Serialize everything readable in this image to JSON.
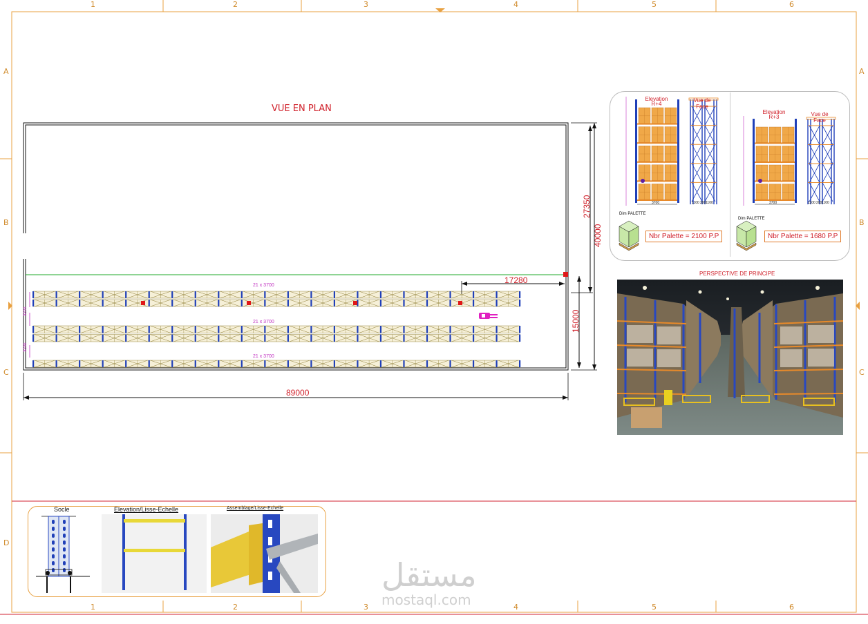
{
  "sheet": {
    "columns": [
      "1",
      "2",
      "3",
      "4",
      "5",
      "6"
    ],
    "rows": [
      "A",
      "B",
      "C",
      "D"
    ]
  },
  "plan": {
    "title": "VUE EN PLAN",
    "dim_width": "89000",
    "dim_height_total": "40000",
    "dim_height_upper": "27350",
    "dim_height_lower": "15000",
    "dim_aisle": "17280",
    "rack_label": "21 x 3700",
    "spacing_label": "3200"
  },
  "elevation_left": {
    "title": "Elevation",
    "subtitle": "R+4",
    "face_title": "Vue de Face",
    "palette_label": "Dim PALETTE",
    "count": "Nbr Palette = 2100 P.P",
    "width_label": "3700",
    "depth_labels": [
      "1100",
      "200",
      "1100"
    ]
  },
  "elevation_right": {
    "title": "Elevation",
    "subtitle": "R+3",
    "face_title": "Vue de Face",
    "palette_label": "Dim PALETTE",
    "count": "Nbr Palette = 1680 P.P",
    "width_label": "3700",
    "depth_labels": [
      "1100",
      "200",
      "1100"
    ]
  },
  "perspective": {
    "title": "PERSPECTIVE DE PRINCIPE"
  },
  "details": {
    "socle": "Socle",
    "elevation": "Elevation/Lisse-Echelle",
    "assemblage": "Assemblage/Lisse-Echelle"
  },
  "watermark": {
    "arabic": "مستقل",
    "latin": "mostaql.com"
  },
  "colors": {
    "frame": "#e8a040",
    "rack_blue": "#1f3fb8",
    "beam_yellow": "#e8c83a",
    "pallet": "#f0a848",
    "marker": "#e01818",
    "forklift": "#e020c0"
  }
}
